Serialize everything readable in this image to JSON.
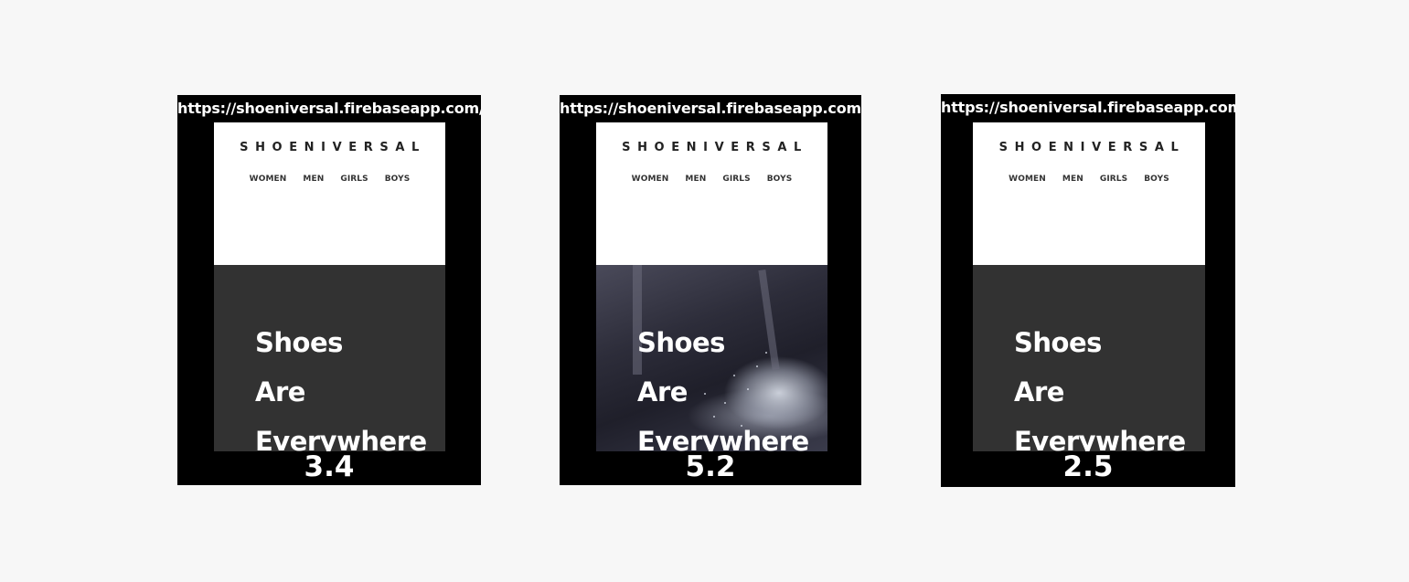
{
  "panels": [
    {
      "url": "https://shoeniversal.firebaseapp.com/",
      "logo": "SHOENIVERSAL",
      "nav": [
        "WOMEN",
        "MEN",
        "GIRLS",
        "BOYS"
      ],
      "headline": [
        "Shoes",
        "Are",
        "Everywhere"
      ],
      "hero_image": "dark-gray-placeholder",
      "score": "3.4"
    },
    {
      "url": "https://shoeniversal.firebaseapp.com/",
      "logo": "SHOENIVERSAL",
      "nav": [
        "WOMEN",
        "MEN",
        "GIRLS",
        "BOYS"
      ],
      "headline": [
        "Shoes",
        "Are",
        "Everywhere"
      ],
      "hero_image": "sneaker-splash-photo",
      "score": "5.2"
    },
    {
      "url": "https://shoeniversal.firebaseapp.com/",
      "logo": "SHOENIVERSAL",
      "nav": [
        "WOMEN",
        "MEN",
        "GIRLS",
        "BOYS"
      ],
      "headline": [
        "Shoes",
        "Are",
        "Everywhere"
      ],
      "hero_image": "dark-gray-placeholder",
      "score": "2.5"
    }
  ],
  "colors": {
    "page_background": "#f7f7f7",
    "frame": "#000000",
    "hero_placeholder": "#323232",
    "text_light": "#ffffff",
    "text_dark": "#222222"
  }
}
